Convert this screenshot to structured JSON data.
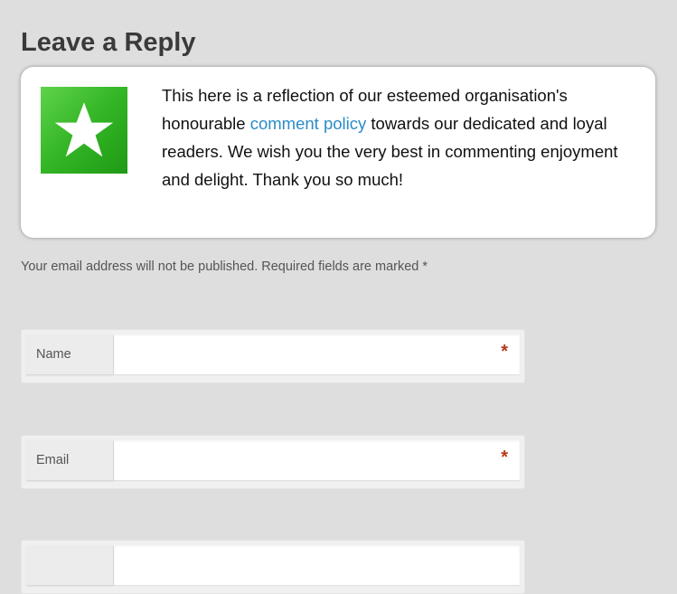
{
  "section": {
    "title": "Leave a Reply"
  },
  "policy": {
    "text_before": "This here is a reflection of our esteemed organisation's honourable ",
    "link_text": "comment policy",
    "text_after": " towards our dedicated and loyal readers. We wish you the very best in commenting enjoyment and delight. Thank you so much!",
    "badge_icon": "star-icon",
    "badge_color": "#33b525"
  },
  "notes": {
    "text": "Your email address will not be published. Required fields are marked *"
  },
  "form": {
    "name_label": "Name",
    "name_value": "",
    "email_label": "Email",
    "email_value": "",
    "website_label": "",
    "required_mark": "*",
    "required_color": "#b83a1a"
  },
  "colors": {
    "link": "#2a8bc7",
    "background": "#dedede"
  }
}
